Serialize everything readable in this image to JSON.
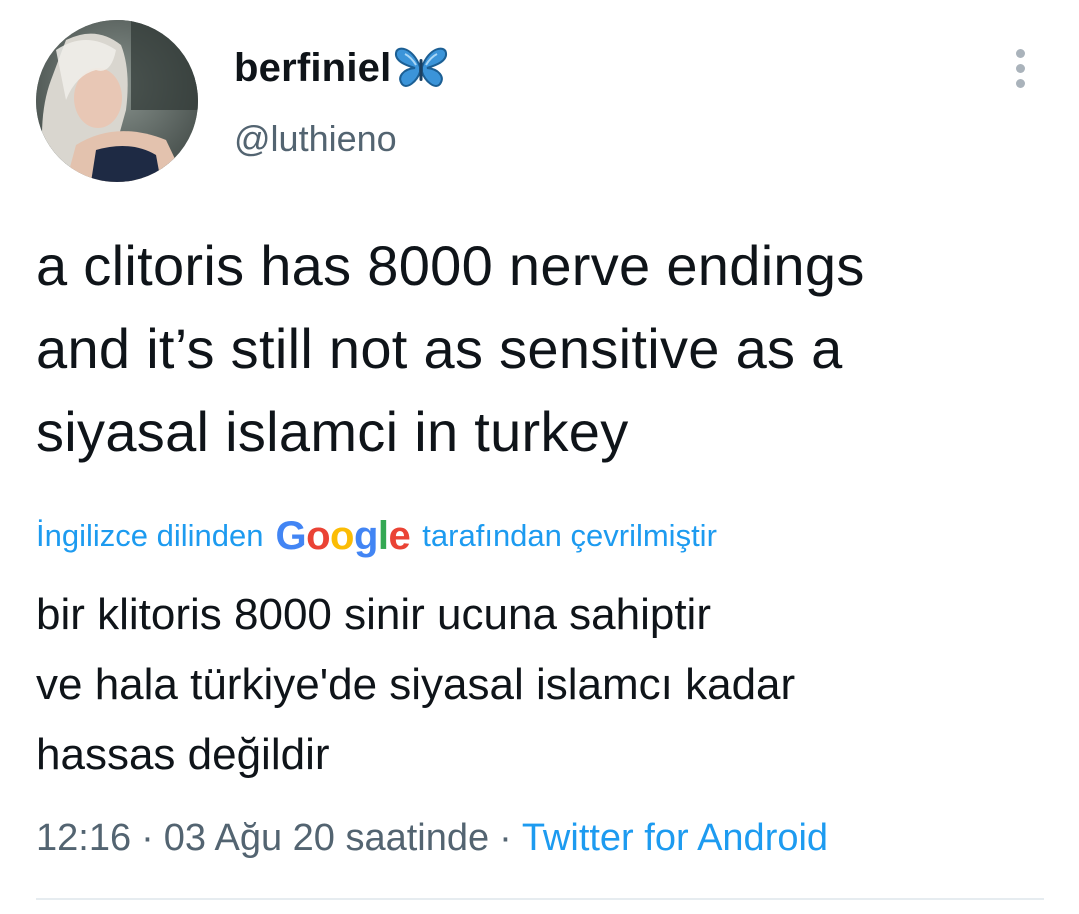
{
  "author": {
    "display_name": "berfiniel",
    "name_emoji": "butterfly",
    "handle": "@luthieno"
  },
  "tweet": {
    "text": "a clitoris has 8000 nerve endings\nand it’s still not as sensitive as a\nsiyasal islamci in turkey"
  },
  "translation": {
    "prefix": "İngilizce dilinden",
    "provider": {
      "G": "G",
      "o1": "o",
      "o2": "o",
      "g": "g",
      "l": "l",
      "e": "e"
    },
    "suffix": "tarafından çevrilmiştir",
    "text": "bir klitoris 8000 sinir ucuna sahiptir\nve hala türkiye'de siyasal islamcı kadar\nhassas değildir"
  },
  "meta": {
    "time": "12:16",
    "date": "03 Ağu 20 saatinde",
    "separator": "·",
    "source": "Twitter for Android"
  },
  "icons": {
    "more": "more-vertical-icon",
    "butterfly": "butterfly-emoji-icon"
  },
  "colors": {
    "link": "#1d9bf0",
    "secondary_text": "#536471",
    "primary_text": "#0f1419"
  }
}
